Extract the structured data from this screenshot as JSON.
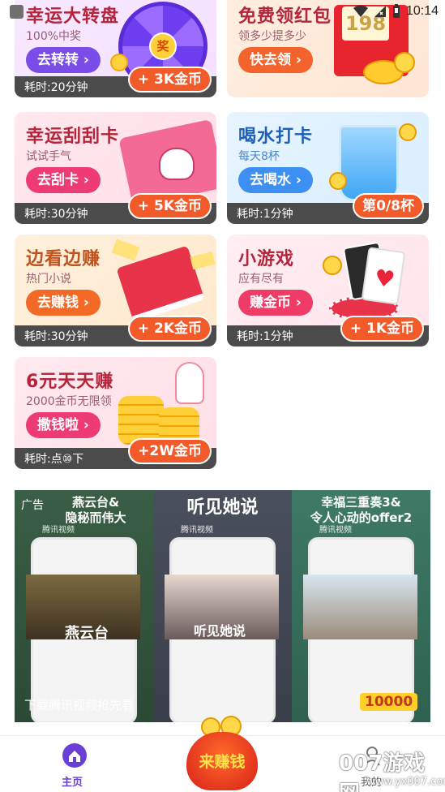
{
  "status_bar": {
    "time": "10:14"
  },
  "cards": [
    {
      "title": "幸运大转盘",
      "subtitle": "100%中奖",
      "button": "去转转 ›",
      "time": "耗时:20分钟",
      "reward": "+ 3K金币",
      "wheel_label": "奖"
    },
    {
      "title": "免费领红包",
      "subtitle": "领多少提多少",
      "button": "快去领 ›",
      "time": "",
      "reward": "",
      "envelope_label": "198"
    },
    {
      "title": "幸运刮刮卡",
      "subtitle": "试试手气",
      "button": "去刮卡 ›",
      "time": "耗时:30分钟",
      "reward": "+ 5K金币"
    },
    {
      "title": "喝水打卡",
      "subtitle": "每天8杯",
      "button": "去喝水 ›",
      "time": "耗时:1分钟",
      "reward": "第0/8杯"
    },
    {
      "title": "边看边赚",
      "subtitle": "热门小说",
      "button": "去赚钱 ›",
      "time": "耗时:30分钟",
      "reward": "+ 2K金币"
    },
    {
      "title": "小游戏",
      "subtitle": "应有尽有",
      "button": "赚金币 ›",
      "time": "耗时:1分钟",
      "reward": "+ 1K金币"
    },
    {
      "title": "6元天天赚",
      "subtitle": "2000金币无限领",
      "button": "撒钱啦 ›",
      "time": "耗时:点⑩下",
      "reward": "+2W金币"
    }
  ],
  "ad": {
    "tag": "广告",
    "panels": [
      {
        "headline": "燕云台&\n隐秘而伟大",
        "brand": "腾讯视频",
        "poster_text": "燕云台"
      },
      {
        "headline": "听见她说",
        "brand": "腾讯视频",
        "poster_text": "听见她说"
      },
      {
        "headline": "幸福三重奏3&\n令人心动的offer2",
        "brand": "腾讯视频",
        "badge": "10000"
      }
    ],
    "cta": "下载腾讯视频抢先看"
  },
  "bottom_nav": {
    "home_label": "主页",
    "earn_label": "来赚钱",
    "mine_label": "我的"
  },
  "watermark": {
    "text": "007游戏网",
    "url": "www.yx007.com"
  },
  "colors": {
    "title": "#b4243a",
    "reward_bg": "#f25a2a",
    "footer_bg": "#4b4b4b",
    "nav_active": "#6a3fd8"
  }
}
